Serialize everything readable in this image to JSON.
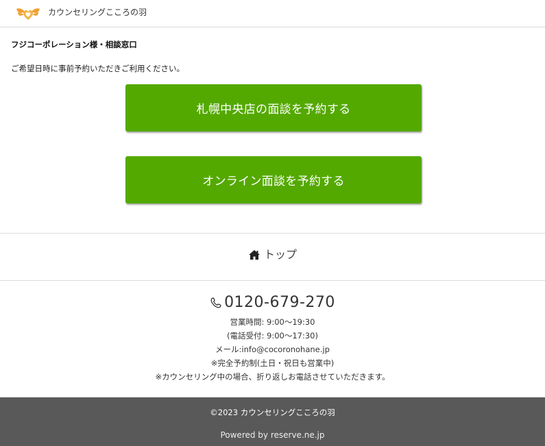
{
  "header": {
    "brand": "カウンセリングこころの羽",
    "logo_icon": "winged-heart-logo",
    "logo_color": "#f0a030"
  },
  "main": {
    "title": "フジコーポレーション様・相談窓口",
    "instruction": "ご希望日時に事前予約いただきご利用ください。",
    "buttons": [
      {
        "label": "札幌中央店の面談を予約する"
      },
      {
        "label": "オンライン面談を予約する"
      }
    ],
    "button_color": "#54a900"
  },
  "nav": {
    "home_icon": "home-icon",
    "top_label": "トップ"
  },
  "contact": {
    "phone_icon": "phone-icon",
    "phone": "0120-679-270",
    "hours": "営業時間: 9:00〜19:30",
    "phone_hours": "(電話受付: 9:00〜17:30)",
    "email": "メール:info@cocoronohane.jp",
    "reservation_note": "※完全予約制(土日・祝日も営業中)",
    "callback_note": "※カウンセリング中の場合、折り返しお電話させていただきます。"
  },
  "footer": {
    "copyright": "©2023 カウンセリングこころの羽",
    "powered": "Powered by reserve.ne.jp",
    "background": "#595959"
  }
}
